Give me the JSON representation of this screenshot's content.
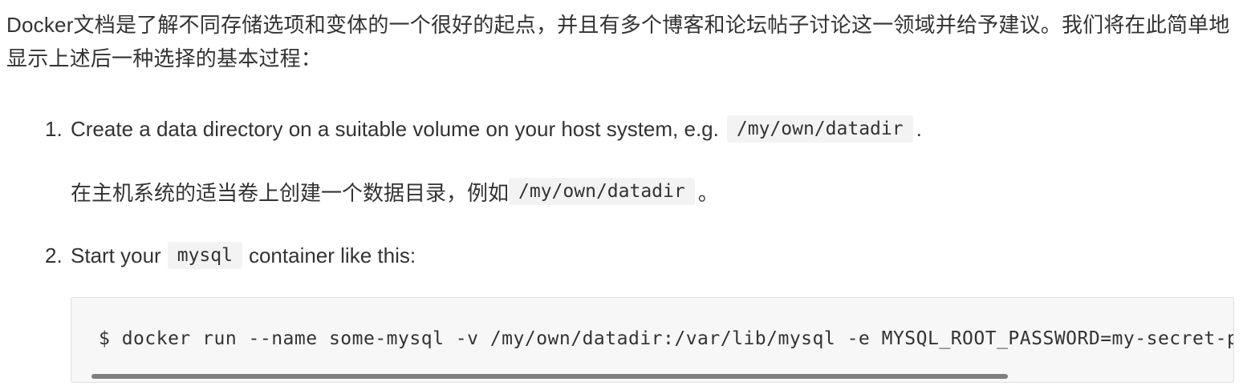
{
  "intro": {
    "text": "Docker文档是了解不同存储选项和变体的一个很好的起点，并且有多个博客和论坛帖子讨论这一领域并给予建议。我们将在此简单地显示上述后一种选择的基本过程："
  },
  "steps": [
    {
      "number": "1.",
      "text_before": "Create a data directory on a suitable volume on your host system, e.g.",
      "code": "/my/own/datadir",
      "text_after": ".",
      "zh_before": "在主机系统的适当卷上创建一个数据目录，例如",
      "zh_code": "/my/own/datadir",
      "zh_after": "。"
    },
    {
      "number": "2.",
      "text_before": "Start your",
      "code": "mysql",
      "text_after": "container like this:"
    }
  ],
  "code_block": {
    "command": "$ docker run --name some-mysql -v /my/own/datadir:/var/lib/mysql -e MYSQL_ROOT_PASSWORD=my-secret-pw -d mysql:tag",
    "scroll_position": 0.0
  },
  "colors": {
    "text": "#333333",
    "code_bg": "#f3f3f3",
    "block_bg": "#f7f7f7",
    "scrollbar": "#7e7e7e"
  }
}
